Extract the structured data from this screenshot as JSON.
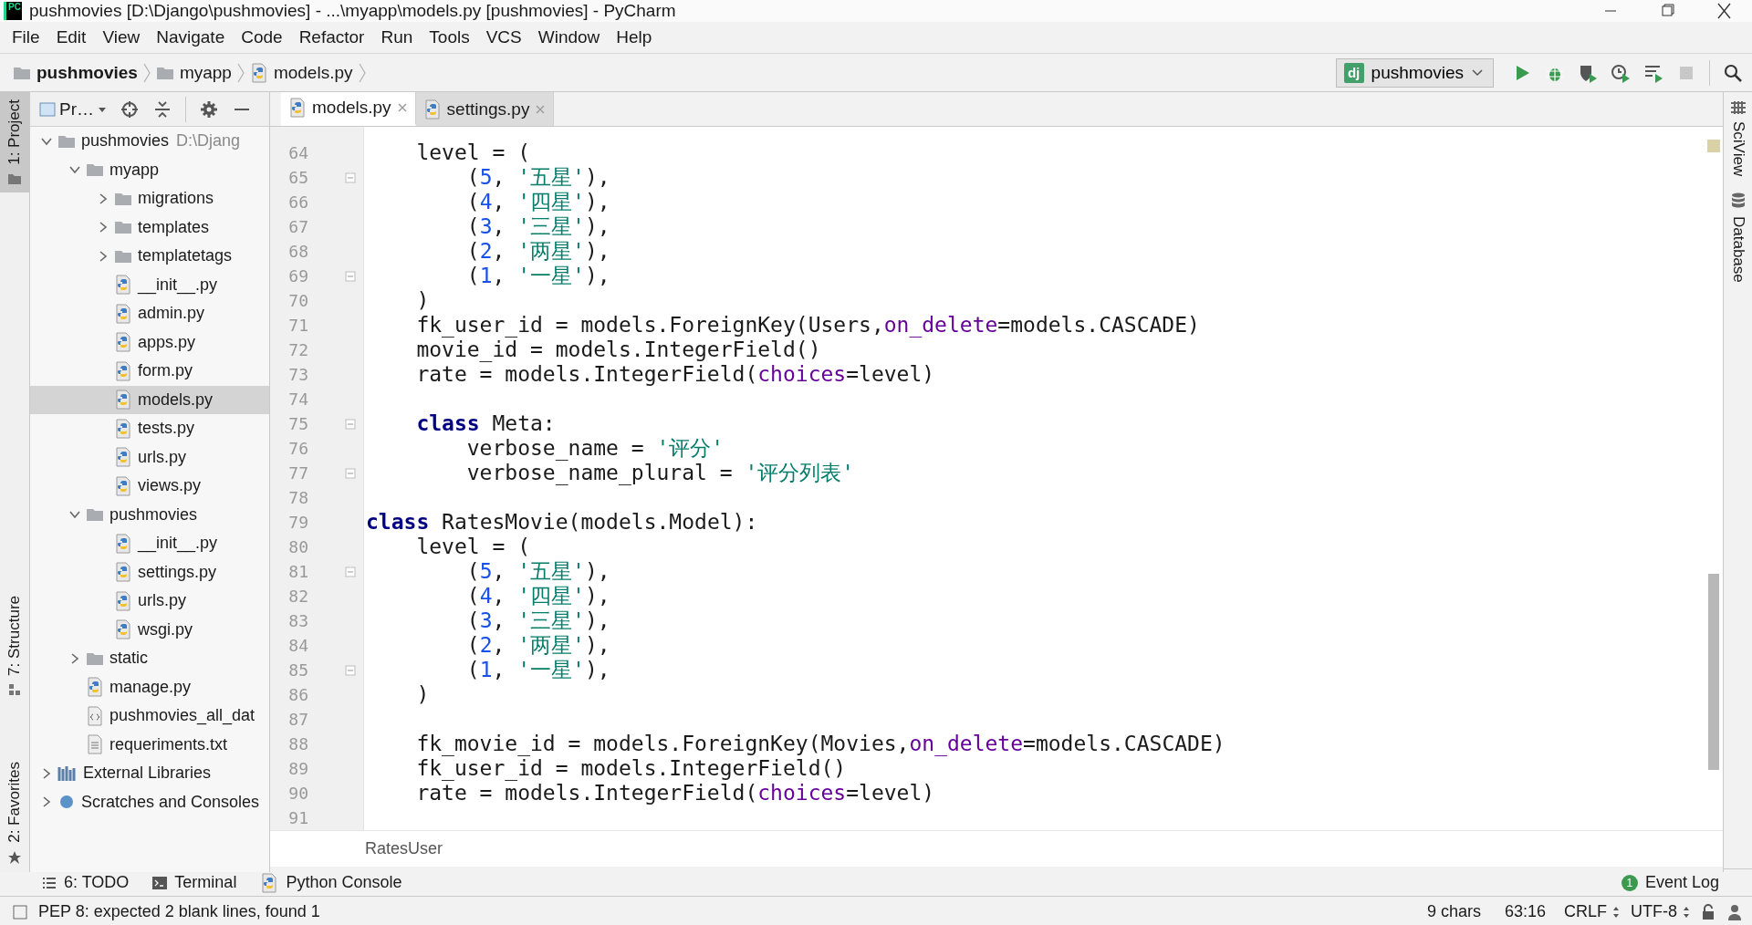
{
  "window": {
    "app_icon": "PC",
    "title": "pushmovies [D:\\Django\\pushmovies] - ...\\myapp\\models.py [pushmovies] - PyCharm"
  },
  "menu": [
    "File",
    "Edit",
    "View",
    "Navigate",
    "Code",
    "Refactor",
    "Run",
    "Tools",
    "VCS",
    "Window",
    "Help"
  ],
  "breadcrumbs": [
    {
      "label": "pushmovies",
      "kind": "folder"
    },
    {
      "label": "myapp",
      "kind": "folder"
    },
    {
      "label": "models.py",
      "kind": "python"
    }
  ],
  "run_config": {
    "icon_text": "dj",
    "label": "pushmovies"
  },
  "left_stripe": [
    {
      "label": "1: Project",
      "kind": "project",
      "selected": true
    },
    {
      "label": "7: Structure",
      "kind": "structure",
      "selected": false
    },
    {
      "label": "2: Favorites",
      "kind": "favorites",
      "selected": false
    }
  ],
  "right_stripe": [
    {
      "label": "SciView",
      "kind": "sciview"
    },
    {
      "label": "Database",
      "kind": "database"
    }
  ],
  "project_panel": {
    "view_label": "Pr…",
    "tree": [
      {
        "label": "pushmovies",
        "hint": "D:\\Djang",
        "kind": "folder",
        "expanded": true,
        "selected": false,
        "children": [
          {
            "label": "myapp",
            "kind": "folder",
            "expanded": true,
            "selected": false,
            "children": [
              {
                "label": "migrations",
                "kind": "folder",
                "expanded": false,
                "selected": false
              },
              {
                "label": "templates",
                "kind": "folder",
                "expanded": false,
                "selected": false
              },
              {
                "label": "templatetags",
                "kind": "folder",
                "expanded": false,
                "selected": false
              },
              {
                "label": "__init__.py",
                "kind": "python",
                "selected": false
              },
              {
                "label": "admin.py",
                "kind": "python",
                "selected": false
              },
              {
                "label": "apps.py",
                "kind": "python",
                "selected": false
              },
              {
                "label": "form.py",
                "kind": "python",
                "selected": false
              },
              {
                "label": "models.py",
                "kind": "python",
                "selected": true
              },
              {
                "label": "tests.py",
                "kind": "python",
                "selected": false
              },
              {
                "label": "urls.py",
                "kind": "python",
                "selected": false
              },
              {
                "label": "views.py",
                "kind": "python",
                "selected": false
              }
            ]
          },
          {
            "label": "pushmovies",
            "kind": "folder",
            "expanded": true,
            "selected": false,
            "children": [
              {
                "label": "__init__.py",
                "kind": "python",
                "selected": false
              },
              {
                "label": "settings.py",
                "kind": "python",
                "selected": false
              },
              {
                "label": "urls.py",
                "kind": "python",
                "selected": false
              },
              {
                "label": "wsgi.py",
                "kind": "python",
                "selected": false
              }
            ]
          },
          {
            "label": "static",
            "kind": "folder",
            "expanded": false,
            "selected": false
          },
          {
            "label": "manage.py",
            "kind": "python",
            "selected": false
          },
          {
            "label": "pushmovies_all_dat",
            "kind": "json",
            "selected": false
          },
          {
            "label": "requeriments.txt",
            "kind": "text",
            "selected": false
          }
        ]
      },
      {
        "label": "External Libraries",
        "kind": "libraries",
        "expanded": false,
        "selected": false
      },
      {
        "label": "Scratches and Consoles",
        "kind": "scratches",
        "expanded": false,
        "selected": false
      }
    ]
  },
  "tabs": [
    {
      "label": "models.py",
      "selected": true
    },
    {
      "label": "settings.py",
      "selected": false
    }
  ],
  "editor": {
    "lines": [
      {
        "n": "64",
        "fold": false,
        "tokens": [
          {
            "kind": "plain",
            "text": "    level = ("
          }
        ]
      },
      {
        "n": "65",
        "fold": true,
        "tokens": [
          {
            "kind": "plain",
            "text": "        ("
          },
          {
            "kind": "number",
            "text": "5"
          },
          {
            "kind": "plain",
            "text": ", "
          },
          {
            "kind": "string",
            "text": "'五星'"
          },
          {
            "kind": "plain",
            "text": "),"
          }
        ]
      },
      {
        "n": "66",
        "fold": false,
        "tokens": [
          {
            "kind": "plain",
            "text": "        ("
          },
          {
            "kind": "number",
            "text": "4"
          },
          {
            "kind": "plain",
            "text": ", "
          },
          {
            "kind": "string",
            "text": "'四星'"
          },
          {
            "kind": "plain",
            "text": "),"
          }
        ]
      },
      {
        "n": "67",
        "fold": false,
        "tokens": [
          {
            "kind": "plain",
            "text": "        ("
          },
          {
            "kind": "number",
            "text": "3"
          },
          {
            "kind": "plain",
            "text": ", "
          },
          {
            "kind": "string",
            "text": "'三星'"
          },
          {
            "kind": "plain",
            "text": "),"
          }
        ]
      },
      {
        "n": "68",
        "fold": false,
        "tokens": [
          {
            "kind": "plain",
            "text": "        ("
          },
          {
            "kind": "number",
            "text": "2"
          },
          {
            "kind": "plain",
            "text": ", "
          },
          {
            "kind": "string",
            "text": "'两星'"
          },
          {
            "kind": "plain",
            "text": "),"
          }
        ]
      },
      {
        "n": "69",
        "fold": true,
        "tokens": [
          {
            "kind": "plain",
            "text": "        ("
          },
          {
            "kind": "number",
            "text": "1"
          },
          {
            "kind": "plain",
            "text": ", "
          },
          {
            "kind": "string",
            "text": "'一星'"
          },
          {
            "kind": "plain",
            "text": "),"
          }
        ]
      },
      {
        "n": "70",
        "fold": false,
        "tokens": [
          {
            "kind": "plain",
            "text": "    )"
          }
        ]
      },
      {
        "n": "71",
        "fold": false,
        "tokens": [
          {
            "kind": "plain",
            "text": "    fk_user_id = models.ForeignKey(Users,"
          },
          {
            "kind": "param",
            "text": "on_delete"
          },
          {
            "kind": "plain",
            "text": "=models.CASCADE)"
          }
        ]
      },
      {
        "n": "72",
        "fold": false,
        "tokens": [
          {
            "kind": "plain",
            "text": "    movie_id = models.IntegerField()"
          }
        ]
      },
      {
        "n": "73",
        "fold": false,
        "tokens": [
          {
            "kind": "plain",
            "text": "    rate = models.IntegerField("
          },
          {
            "kind": "param",
            "text": "choices"
          },
          {
            "kind": "plain",
            "text": "=level)"
          }
        ]
      },
      {
        "n": "74",
        "fold": false
      },
      {
        "n": "75",
        "fold": true,
        "tokens": [
          {
            "kind": "keyword",
            "text": "    class"
          },
          {
            "kind": "plain",
            "text": " Meta:"
          }
        ]
      },
      {
        "n": "76",
        "fold": false,
        "tokens": [
          {
            "kind": "plain",
            "text": "        verbose_name = "
          },
          {
            "kind": "string",
            "text": "'评分'"
          }
        ]
      },
      {
        "n": "77",
        "fold": true,
        "tokens": [
          {
            "kind": "plain",
            "text": "        verbose_name_plural = "
          },
          {
            "kind": "string",
            "text": "'评分列表'"
          }
        ]
      },
      {
        "n": "78",
        "fold": false
      },
      {
        "n": "79",
        "fold": false,
        "tokens": [
          {
            "kind": "keyword",
            "text": "class"
          },
          {
            "kind": "plain",
            "text": " RatesMovie(models.Model):"
          }
        ]
      },
      {
        "n": "80",
        "fold": false,
        "tokens": [
          {
            "kind": "plain",
            "text": "    level = ("
          }
        ]
      },
      {
        "n": "81",
        "fold": true,
        "tokens": [
          {
            "kind": "plain",
            "text": "        ("
          },
          {
            "kind": "number",
            "text": "5"
          },
          {
            "kind": "plain",
            "text": ", "
          },
          {
            "kind": "string",
            "text": "'五星'"
          },
          {
            "kind": "plain",
            "text": "),"
          }
        ]
      },
      {
        "n": "82",
        "fold": false,
        "tokens": [
          {
            "kind": "plain",
            "text": "        ("
          },
          {
            "kind": "number",
            "text": "4"
          },
          {
            "kind": "plain",
            "text": ", "
          },
          {
            "kind": "string",
            "text": "'四星'"
          },
          {
            "kind": "plain",
            "text": "),"
          }
        ]
      },
      {
        "n": "83",
        "fold": false,
        "tokens": [
          {
            "kind": "plain",
            "text": "        ("
          },
          {
            "kind": "number",
            "text": "3"
          },
          {
            "kind": "plain",
            "text": ", "
          },
          {
            "kind": "string",
            "text": "'三星'"
          },
          {
            "kind": "plain",
            "text": "),"
          }
        ]
      },
      {
        "n": "84",
        "fold": false,
        "tokens": [
          {
            "kind": "plain",
            "text": "        ("
          },
          {
            "kind": "number",
            "text": "2"
          },
          {
            "kind": "plain",
            "text": ", "
          },
          {
            "kind": "string",
            "text": "'两星'"
          },
          {
            "kind": "plain",
            "text": "),"
          }
        ]
      },
      {
        "n": "85",
        "fold": true,
        "tokens": [
          {
            "kind": "plain",
            "text": "        ("
          },
          {
            "kind": "number",
            "text": "1"
          },
          {
            "kind": "plain",
            "text": ", "
          },
          {
            "kind": "string",
            "text": "'一星'"
          },
          {
            "kind": "plain",
            "text": "),"
          }
        ]
      },
      {
        "n": "86",
        "fold": false,
        "tokens": [
          {
            "kind": "plain",
            "text": "    )"
          }
        ]
      },
      {
        "n": "87",
        "fold": false
      },
      {
        "n": "88",
        "fold": false,
        "tokens": [
          {
            "kind": "plain",
            "text": "    fk_movie_id = models.ForeignKey(Movies,"
          },
          {
            "kind": "param",
            "text": "on_delete"
          },
          {
            "kind": "plain",
            "text": "=models.CASCADE)"
          }
        ]
      },
      {
        "n": "89",
        "fold": false,
        "tokens": [
          {
            "kind": "plain",
            "text": "    fk_user_id = models.IntegerField()"
          }
        ]
      },
      {
        "n": "90",
        "fold": false,
        "tokens": [
          {
            "kind": "plain",
            "text": "    rate = models.IntegerField("
          },
          {
            "kind": "param",
            "text": "choices"
          },
          {
            "kind": "plain",
            "text": "=level)"
          }
        ]
      },
      {
        "n": "91",
        "fold": false
      }
    ],
    "breadcrumb": "RatesUser"
  },
  "tool_windows": [
    {
      "label": "6: TODO",
      "kind": "todo"
    },
    {
      "label": "Terminal",
      "kind": "terminal"
    },
    {
      "label": "Python Console",
      "kind": "console"
    }
  ],
  "event_log": {
    "count": "1",
    "label": "Event Log"
  },
  "status_bar": {
    "message": "PEP 8: expected 2 blank lines, found 1",
    "chars": "9 chars",
    "position": "63:16",
    "line_separator": "CRLF",
    "encoding": "UTF-8"
  }
}
